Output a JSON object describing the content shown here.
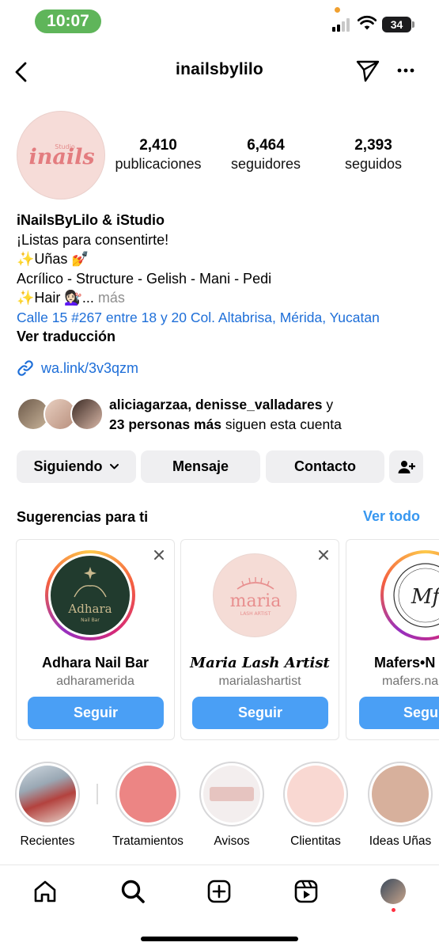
{
  "status_bar": {
    "time": "10:07",
    "battery": "34"
  },
  "header": {
    "username": "inailsbylilo"
  },
  "profile": {
    "logo_text": "nails",
    "logo_small": "Studio",
    "stats": [
      {
        "value": "2,410",
        "label": "publicaciones"
      },
      {
        "value": "6,464",
        "label": "seguidores"
      },
      {
        "value": "2,393",
        "label": "seguidos"
      }
    ]
  },
  "bio": {
    "name": "iNailsByLilo & iStudio",
    "line1": "¡Listas para consentirte!",
    "line2": "✨Uñas 💅",
    "line3": "Acrílico - Structure - Gelish - Mani - Pedi",
    "line4": "✨Hair 💇🏻‍♀️...",
    "more": "más",
    "address": "Calle 15 #267 entre 18 y 20 Col. Altabrisa, Mérida, Yucatan",
    "translate": "Ver traducción",
    "link": "wa.link/3v3qzm"
  },
  "followed_by": {
    "names": "aliciagarzaa, denisse_valladares",
    "connector": " y",
    "others": "23 personas más",
    "suffix": " siguen esta cuenta"
  },
  "buttons": {
    "following": "Siguiendo",
    "message": "Mensaje",
    "contact": "Contacto"
  },
  "suggestions": {
    "title": "Sugerencias para ti",
    "see_all": "Ver todo",
    "cards": [
      {
        "name": "Adhara Nail Bar",
        "handle": "adharamerida",
        "button": "Seguir",
        "logo_title": "Adhara",
        "logo_sub": "Nail Bar"
      },
      {
        "name": "Maria Lash Artist",
        "handle": "marialashartist",
        "button": "Seguir",
        "logo_title": "maria",
        "logo_sub": "LASH ARTIST"
      },
      {
        "name": "Mafers•N",
        "handle": "mafers.na",
        "button": "Segu",
        "logo_title": "Mf"
      }
    ]
  },
  "highlights": [
    {
      "label": "Recientes"
    },
    {
      "label": "Tratamientos",
      "color": "#ec8584"
    },
    {
      "label": "Avisos"
    },
    {
      "label": "Clientitas",
      "color": "#f9d8d2"
    },
    {
      "label": "Ideas Uñas",
      "color": "#d7b09c"
    }
  ],
  "colors": {
    "accent_blue": "#3797f0",
    "follow_button": "#4a9ff5",
    "link_blue": "#1d6ed8",
    "status_green": "#5fb55a"
  }
}
